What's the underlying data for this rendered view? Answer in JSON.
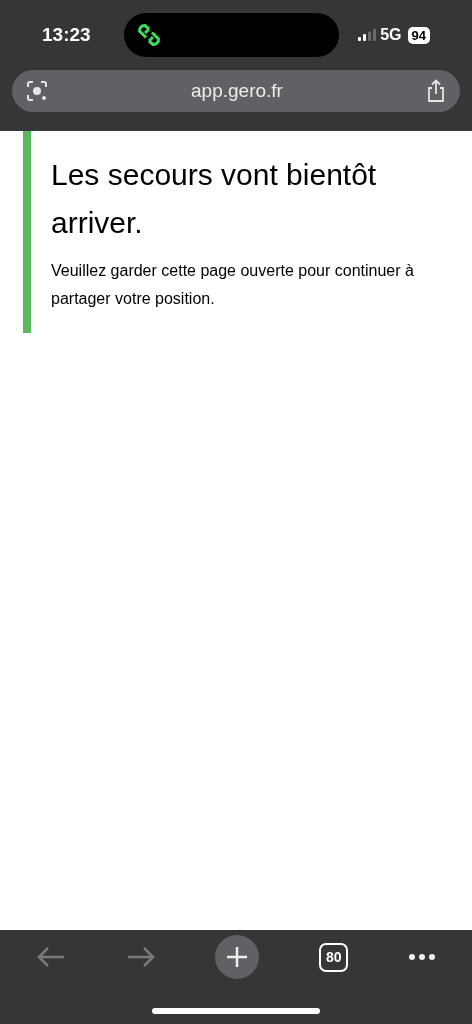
{
  "status_bar": {
    "time": "13:23",
    "network": "5G",
    "battery": "94"
  },
  "address_bar": {
    "url": "app.gero.fr"
  },
  "notice": {
    "title": "Les secours vont bientôt arriver.",
    "message": "Veuillez garder cette page ouverte pour continuer à partager votre position."
  },
  "toolbar": {
    "back_disabled": true,
    "forward_disabled": true,
    "tab_count": "80"
  }
}
